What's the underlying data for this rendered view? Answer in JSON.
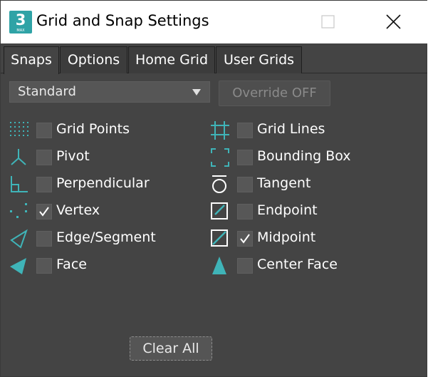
{
  "window": {
    "title": "Grid and Snap Settings",
    "app_icon_number": "3",
    "app_icon_sub": "MAX"
  },
  "tabs": [
    {
      "label": "Snaps",
      "active": true
    },
    {
      "label": "Options",
      "active": false
    },
    {
      "label": "Home Grid",
      "active": false
    },
    {
      "label": "User Grids",
      "active": false
    }
  ],
  "dropdown": {
    "selected": "Standard"
  },
  "override_button": {
    "label": "Override OFF",
    "enabled": false
  },
  "snaps": {
    "left": [
      {
        "label": "Grid Points",
        "icon": "grid-points-icon",
        "checked": false
      },
      {
        "label": "Pivot",
        "icon": "pivot-icon",
        "checked": false
      },
      {
        "label": "Perpendicular",
        "icon": "perpendicular-icon",
        "checked": false
      },
      {
        "label": "Vertex",
        "icon": "vertex-icon",
        "checked": true
      },
      {
        "label": "Edge/Segment",
        "icon": "edge-segment-icon",
        "checked": false
      },
      {
        "label": "Face",
        "icon": "face-icon",
        "checked": false
      }
    ],
    "right": [
      {
        "label": "Grid Lines",
        "icon": "grid-lines-icon",
        "checked": false
      },
      {
        "label": "Bounding Box",
        "icon": "bounding-box-icon",
        "checked": false
      },
      {
        "label": "Tangent",
        "icon": "tangent-icon",
        "checked": false
      },
      {
        "label": "Endpoint",
        "icon": "endpoint-icon",
        "checked": false
      },
      {
        "label": "Midpoint",
        "icon": "midpoint-icon",
        "checked": true
      },
      {
        "label": "Center Face",
        "icon": "center-face-icon",
        "checked": false
      }
    ]
  },
  "clear_all_button": {
    "label": "Clear All"
  },
  "colors": {
    "background": "#444444",
    "accent": "#3fb4b8",
    "titlebar": "#ffffff",
    "text": "#ffffff"
  }
}
